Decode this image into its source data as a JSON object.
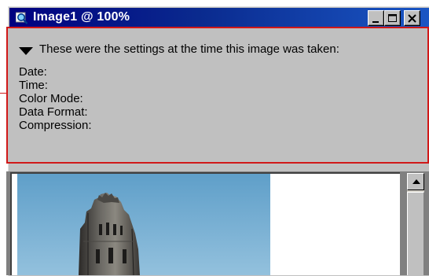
{
  "window": {
    "title": "Image1 @ 100%"
  },
  "info_panel": {
    "header": "These were the settings at the time this image was taken:",
    "fields": [
      {
        "label": "Date:"
      },
      {
        "label": "Time:"
      },
      {
        "label": "Color Mode:"
      },
      {
        "label": "Data Format:"
      },
      {
        "label": "Compression:"
      }
    ]
  },
  "colors": {
    "titlebar_start": "#000080",
    "titlebar_end": "#1a56c4",
    "highlight_border": "#d01818",
    "panel_bg": "#c0c0c0"
  },
  "icons": {
    "title_icon": "magnifier-image-icon",
    "minimize": "minimize-icon",
    "maximize": "maximize-icon",
    "close": "close-icon",
    "disclosure": "triangle-down-icon",
    "scroll_up": "scroll-up-arrow-icon"
  }
}
